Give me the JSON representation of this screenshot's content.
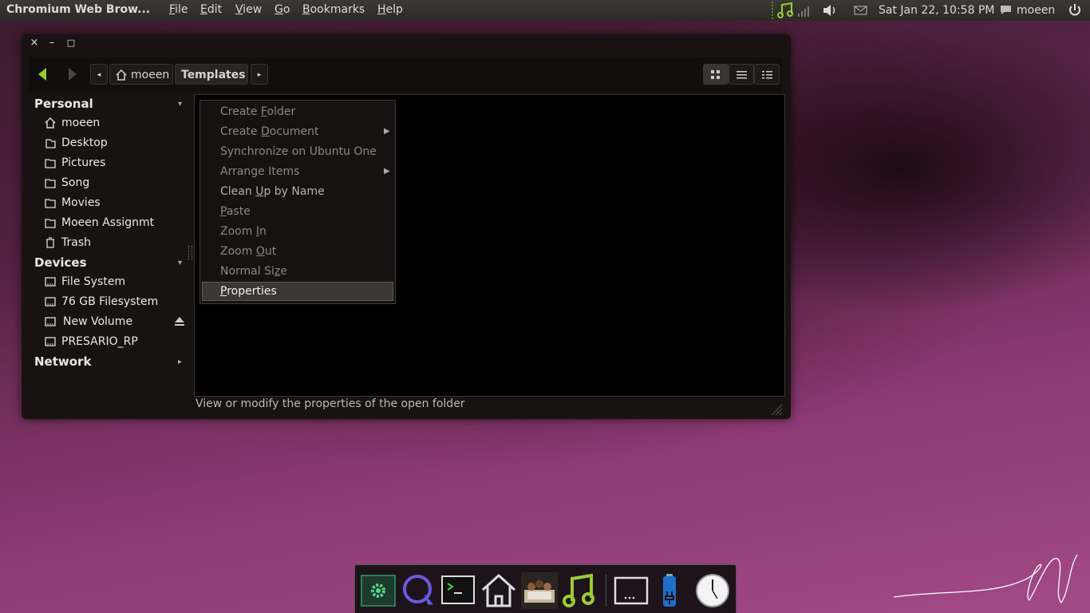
{
  "top_panel": {
    "app_title": "Chromium Web Brow...",
    "menus": [
      "File",
      "Edit",
      "View",
      "Go",
      "Bookmarks",
      "Help"
    ],
    "clock": "Sat Jan 22, 10:58 PM",
    "user": "moeen",
    "accent_color": "#9acd32"
  },
  "window": {
    "close": "×",
    "minimize": "–",
    "maximize": "□",
    "breadcrumbs": [
      "moeen",
      "Templates"
    ],
    "view_modes": [
      "icon-view",
      "list-view",
      "compact-view"
    ]
  },
  "sidebar": {
    "personal": "Personal",
    "personal_items": [
      "moeen",
      "Desktop",
      "Pictures",
      "Song",
      "Movies",
      "Moeen Assignmt",
      "Trash"
    ],
    "devices": "Devices",
    "device_items": [
      "File System",
      "76 GB Filesystem",
      "New Volume",
      "PRESARIO_RP"
    ],
    "network": "Network"
  },
  "context_menu": {
    "items": [
      {
        "label": "Create Folder",
        "mnemonic_index": 7,
        "submenu": false
      },
      {
        "label": "Create Document",
        "mnemonic_index": 7,
        "submenu": true
      },
      {
        "label": "Synchronize on Ubuntu One",
        "mnemonic_index": -1,
        "submenu": false
      },
      {
        "label": "Arrange Items",
        "mnemonic_index": -1,
        "submenu": true
      },
      {
        "label": "Clean Up by Name",
        "mnemonic_index": 6,
        "submenu": false
      },
      {
        "label": "Paste",
        "mnemonic_index": 0,
        "submenu": false
      },
      {
        "label": "Zoom In",
        "mnemonic_index": 5,
        "submenu": false
      },
      {
        "label": "Zoom Out",
        "mnemonic_index": 5,
        "submenu": false
      },
      {
        "label": "Normal Size",
        "mnemonic_index": 9,
        "submenu": false
      },
      {
        "label": "Properties",
        "mnemonic_index": 0,
        "submenu": false
      }
    ],
    "highlighted": "Properties"
  },
  "status_text": "View or modify the properties of the open folder",
  "dock": {
    "icons": [
      "settings-icon",
      "search-lens-icon",
      "terminal-icon",
      "home-folder-icon",
      "group-photo-icon",
      "music-icon",
      "screen-icon",
      "battery-icon",
      "clock-icon"
    ]
  }
}
